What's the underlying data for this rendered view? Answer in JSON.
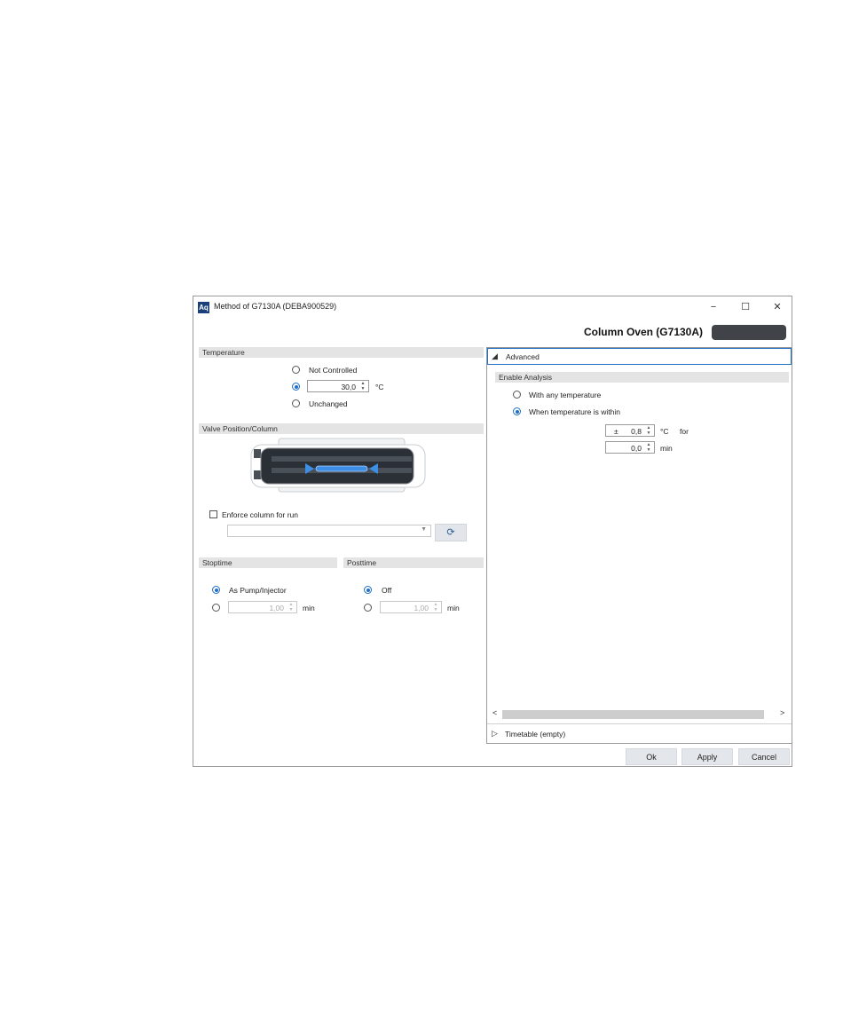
{
  "window": {
    "logo_text": "Aq",
    "title": "Method of G7130A (DEBA900529)",
    "minimize": "−",
    "maximize": "☐",
    "close": "✕"
  },
  "header": {
    "heading": "Column Oven (G7130A)"
  },
  "temperature": {
    "section_label": "Temperature",
    "options": [
      "Not Controlled",
      "",
      "Unchanged"
    ],
    "selected_index": 1,
    "value": "30,0",
    "unit": "°C"
  },
  "valve": {
    "section_label": "Valve Position/Column",
    "enforce_label": "Enforce column for run",
    "enforce_checked": false,
    "dropdown_value": "",
    "refresh_icon": "⟳"
  },
  "stoptime": {
    "section_label": "Stoptime",
    "option_label": "As Pump/Injector",
    "value": "1,00",
    "unit": "min",
    "selected_index": 0
  },
  "posttime": {
    "section_label": "Posttime",
    "option_label": "Off",
    "value": "1,00",
    "unit": "min",
    "selected_index": 0
  },
  "advanced": {
    "header_label": "Advanced",
    "expand_icon": "◢",
    "enable_section_label": "Enable Analysis",
    "options": [
      "With any temperature",
      "When temperature is within"
    ],
    "selected_index": 1,
    "plusminus": "±",
    "tolerance_value": "0,8",
    "tolerance_unit": "°C",
    "for_label": "for",
    "time_value": "0,0",
    "time_unit": "min"
  },
  "timetable": {
    "label": "Timetable (empty)",
    "collapse_icon": "▷"
  },
  "scroll": {
    "left_arrow": "<",
    "right_arrow": ">"
  },
  "footer": {
    "ok_label": "Ok",
    "apply_label": "Apply",
    "cancel_label": "Cancel"
  },
  "colors": {
    "accent": "#1f6fc5",
    "section_bg": "#e4e4e4",
    "button_bg": "#e3e6ea",
    "valve_dark": "#2b3036"
  }
}
